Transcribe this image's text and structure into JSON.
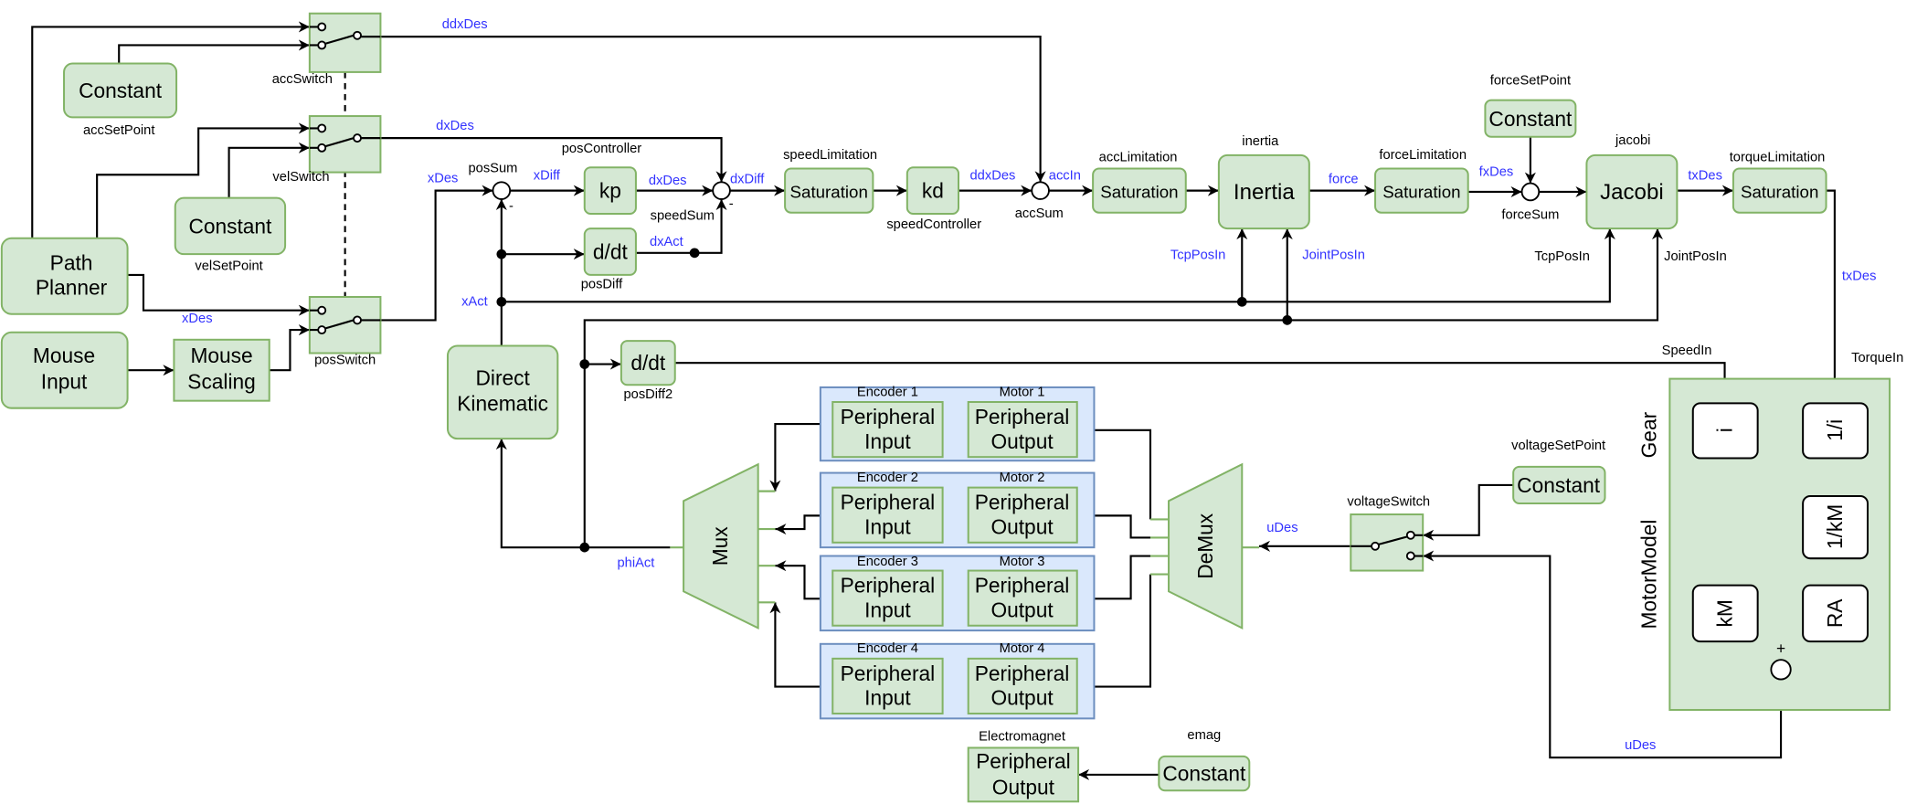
{
  "colors": {
    "block_fill": "#d5e8d4",
    "block_stroke": "#82b366",
    "group_fill": "#dae8fc",
    "group_stroke": "#6c8ebf",
    "signal_text": "#3333ff"
  },
  "blocks": {
    "acc_const": {
      "text": "Constant",
      "caption": "accSetPoint"
    },
    "vel_const": {
      "text": "Constant",
      "caption": "velSetPoint"
    },
    "path_planner": {
      "line1": "Path",
      "line2": "Planner"
    },
    "mouse_input": {
      "line1": "Mouse",
      "line2": "Input"
    },
    "mouse_scaling": {
      "line1": "Mouse",
      "line2": "Scaling"
    },
    "acc_switch": {
      "caption": "accSwitch"
    },
    "vel_switch": {
      "caption": "velSwitch"
    },
    "pos_switch": {
      "caption": "posSwitch"
    },
    "pos_sum": {
      "caption": "posSum",
      "sign": "-"
    },
    "kp": {
      "text": "kp",
      "caption": "posController"
    },
    "pos_diff": {
      "text": "d/dt",
      "caption": "posDiff"
    },
    "speed_sum": {
      "caption": "speedSum",
      "sign": "-"
    },
    "speed_sat": {
      "text": "Saturation",
      "caption": "speedLimitation"
    },
    "kd": {
      "text": "kd",
      "caption": "speedController"
    },
    "acc_sum": {
      "caption": "accSum"
    },
    "acc_sat": {
      "text": "Saturation",
      "caption": "accLimitation"
    },
    "inertia": {
      "text": "Inertia",
      "caption": "inertia"
    },
    "force_sat": {
      "text": "Saturation",
      "caption": "forceLimitation"
    },
    "force_const": {
      "text": "Constant",
      "caption": "forceSetPoint"
    },
    "force_sum": {
      "caption": "forceSum"
    },
    "jacobi": {
      "text": "Jacobi",
      "caption": "jacobi"
    },
    "torque_sat": {
      "text": "Saturation",
      "caption": "torqueLimitation"
    },
    "direct_kinematic": {
      "line1": "Direct",
      "line2": "Kinematic"
    },
    "pos_diff2": {
      "text": "d/dt",
      "caption": "posDiff2"
    },
    "mux": {
      "text": "Mux"
    },
    "demux": {
      "text": "DeMux"
    },
    "voltage_switch": {
      "caption": "voltageSwitch"
    },
    "voltage_const": {
      "text": "Constant",
      "caption": "voltageSetPoint"
    },
    "electromagnet": {
      "line1": "Peripheral",
      "line2": "Output",
      "caption": "Electromagnet"
    },
    "emag_const": {
      "text": "Constant",
      "caption": "emag"
    },
    "motor_model": {
      "gear_label": "Gear",
      "model_label": "MotorModel",
      "i": "i",
      "inv_i": "1/i",
      "inv_km": "1/kM",
      "km": "kM",
      "ra": "RA",
      "plus": "+"
    }
  },
  "peripherals": [
    {
      "encoder": "Encoder 1",
      "motor": "Motor 1",
      "in1": "Peripheral",
      "in2": "Input",
      "out1": "Peripheral",
      "out2": "Output"
    },
    {
      "encoder": "Encoder 2",
      "motor": "Motor 2",
      "in1": "Peripheral",
      "in2": "Input",
      "out1": "Peripheral",
      "out2": "Output"
    },
    {
      "encoder": "Encoder 3",
      "motor": "Motor 3",
      "in1": "Peripheral",
      "in2": "Input",
      "out1": "Peripheral",
      "out2": "Output"
    },
    {
      "encoder": "Encoder 4",
      "motor": "Motor 4",
      "in1": "Peripheral",
      "in2": "Input",
      "out1": "Peripheral",
      "out2": "Output"
    }
  ],
  "signals": {
    "ddxDes_top": "ddxDes",
    "dxDes_top": "dxDes",
    "xDes_planner": "xDes",
    "xDes": "xDes",
    "xDiff": "xDiff",
    "dxDes": "dxDes",
    "dxAct": "dxAct",
    "dxDiff": "dxDiff",
    "ddxDes": "ddxDes",
    "accIn": "accIn",
    "force": "force",
    "fxDes": "fxDes",
    "txDes": "txDes",
    "txDes_down": "txDes",
    "xAct": "xAct",
    "phiAct": "phiAct",
    "tcp_in_inertia": "TcpPosIn",
    "joint_in_inertia": "JointPosIn",
    "tcp_in_jacobi": "TcpPosIn",
    "joint_in_jacobi": "JointPosIn",
    "speed_in": "SpeedIn",
    "torque_in": "TorqueIn",
    "uDes_demux": "uDes",
    "uDes_motor": "uDes"
  }
}
